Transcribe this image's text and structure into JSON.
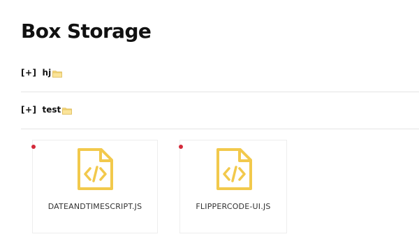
{
  "page": {
    "title": "Box Storage"
  },
  "folders": [
    {
      "toggle": "[+]",
      "name": "hj",
      "icon": "folder-icon"
    },
    {
      "toggle": "[+]",
      "name": "test",
      "icon": "folder-icon"
    }
  ],
  "files": [
    {
      "name": "DATEANDTIMESCRIPT.JS",
      "icon": "code-file-icon",
      "status": "red-dot"
    },
    {
      "name": "FLIPPERCODE-UI.JS",
      "icon": "code-file-icon",
      "status": "red-dot"
    }
  ],
  "colors": {
    "icon_yellow": "#f2c94c",
    "status_red": "#d42a3a",
    "divider": "#e4e4e4",
    "folder_icon": "#f5d77a"
  }
}
